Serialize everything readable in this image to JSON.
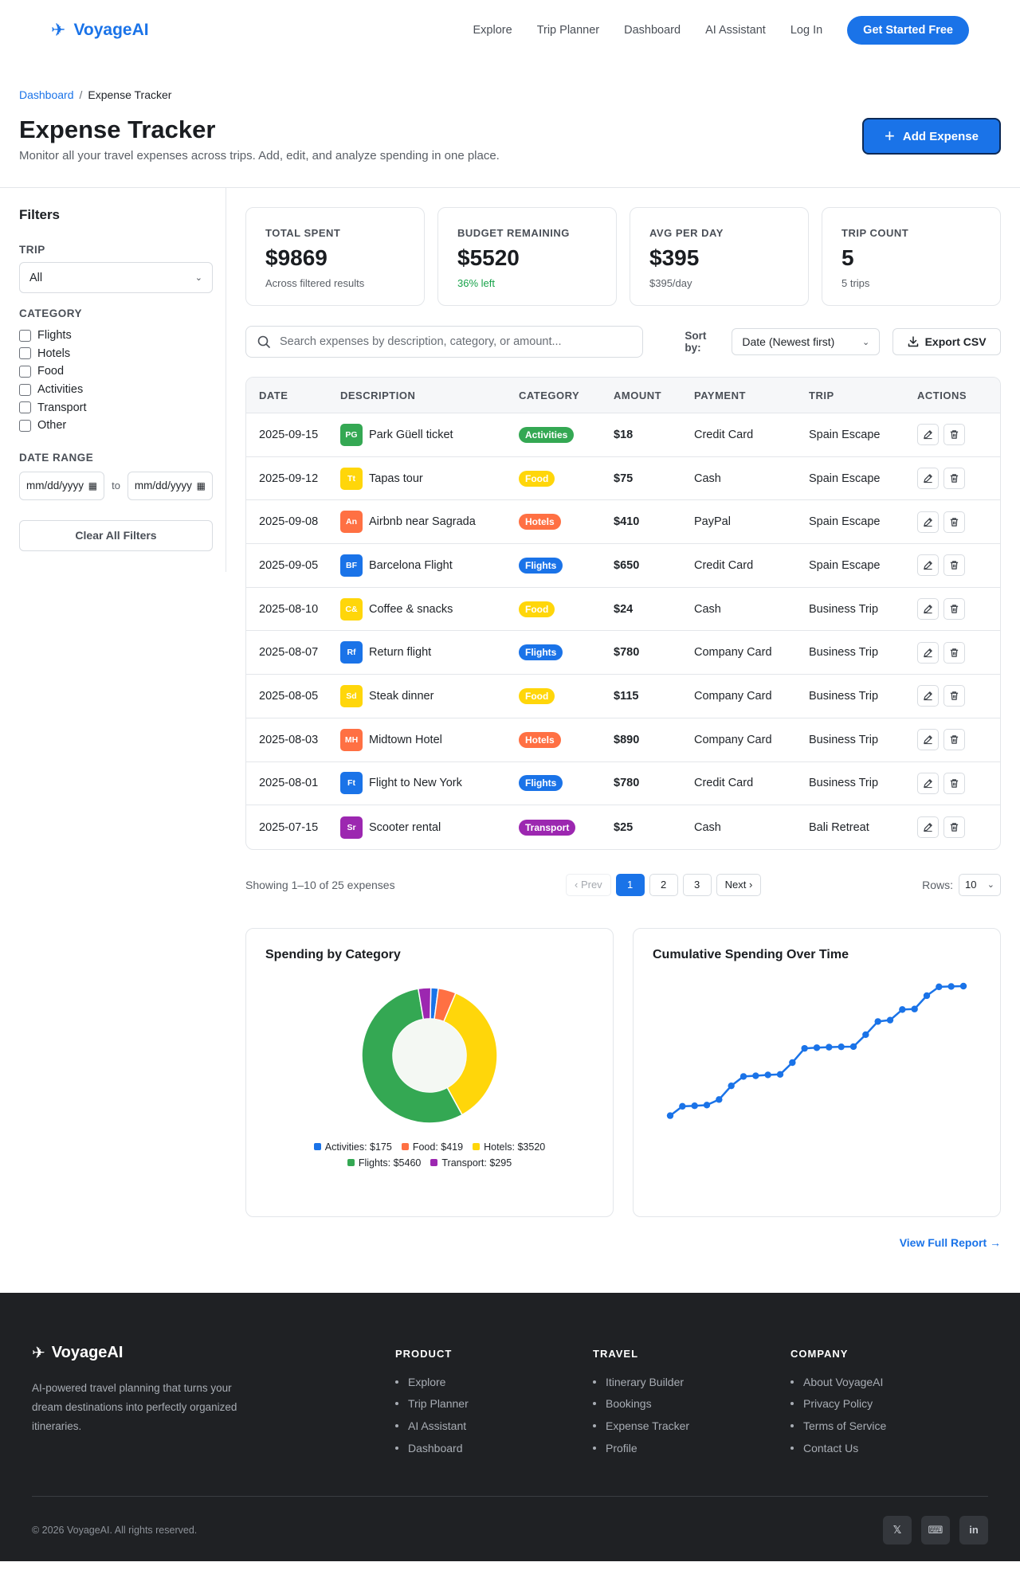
{
  "nav": {
    "brand": "VoyageAI",
    "links": [
      "Explore",
      "Trip Planner",
      "Dashboard",
      "AI Assistant",
      "Log In"
    ],
    "cta": "Get Started Free"
  },
  "breadcrumb": {
    "parent": "Dashboard",
    "sep": "/",
    "current": "Expense Tracker"
  },
  "header": {
    "title": "Expense Tracker",
    "subtitle": "Monitor all your travel expenses across trips. Add, edit, and analyze spending in one place.",
    "add_button": "Add Expense"
  },
  "filters": {
    "title": "Filters",
    "trip_label": "TRIP",
    "trip_value": "All",
    "category_label": "CATEGORY",
    "categories": [
      "Flights",
      "Hotels",
      "Food",
      "Activities",
      "Transport",
      "Other"
    ],
    "date_label": "DATE RANGE",
    "date_placeholder": "mm/dd/yyyy",
    "to": "to",
    "clear": "Clear All Filters"
  },
  "stats": [
    {
      "label": "TOTAL SPENT",
      "value": "$9869",
      "note": "Across filtered results"
    },
    {
      "label": "BUDGET REMAINING",
      "value": "$5520",
      "note": "36% left"
    },
    {
      "label": "AVG PER DAY",
      "value": "$395",
      "note": "$395/day"
    },
    {
      "label": "TRIP COUNT",
      "value": "5",
      "note": "5 trips"
    }
  ],
  "toolbar": {
    "search_placeholder": "Search expenses by description, category, or amount...",
    "sort_label": "Sort by:",
    "sort_value": "Date (Newest first)",
    "export": "Export CSV"
  },
  "table": {
    "headers": [
      "DATE",
      "DESCRIPTION",
      "CATEGORY",
      "AMOUNT",
      "PAYMENT",
      "TRIP",
      "ACTIONS"
    ],
    "rows": [
      {
        "date": "2025-09-15",
        "initials": "PG",
        "desc": "Park Güell ticket",
        "cat": "Activities",
        "amount": "$18",
        "payment": "Credit Card",
        "trip": "Spain Escape"
      },
      {
        "date": "2025-09-12",
        "initials": "Tt",
        "desc": "Tapas tour",
        "cat": "Food",
        "amount": "$75",
        "payment": "Cash",
        "trip": "Spain Escape"
      },
      {
        "date": "2025-09-08",
        "initials": "An",
        "desc": "Airbnb near Sagrada",
        "cat": "Hotels",
        "amount": "$410",
        "payment": "PayPal",
        "trip": "Spain Escape"
      },
      {
        "date": "2025-09-05",
        "initials": "BF",
        "desc": "Barcelona Flight",
        "cat": "Flights",
        "amount": "$650",
        "payment": "Credit Card",
        "trip": "Spain Escape"
      },
      {
        "date": "2025-08-10",
        "initials": "C&",
        "desc": "Coffee & snacks",
        "cat": "Food",
        "amount": "$24",
        "payment": "Cash",
        "trip": "Business Trip"
      },
      {
        "date": "2025-08-07",
        "initials": "Rf",
        "desc": "Return flight",
        "cat": "Flights",
        "amount": "$780",
        "payment": "Company Card",
        "trip": "Business Trip"
      },
      {
        "date": "2025-08-05",
        "initials": "Sd",
        "desc": "Steak dinner",
        "cat": "Food",
        "amount": "$115",
        "payment": "Company Card",
        "trip": "Business Trip"
      },
      {
        "date": "2025-08-03",
        "initials": "MH",
        "desc": "Midtown Hotel",
        "cat": "Hotels",
        "amount": "$890",
        "payment": "Company Card",
        "trip": "Business Trip"
      },
      {
        "date": "2025-08-01",
        "initials": "Ft",
        "desc": "Flight to New York",
        "cat": "Flights",
        "amount": "$780",
        "payment": "Credit Card",
        "trip": "Business Trip"
      },
      {
        "date": "2025-07-15",
        "initials": "Sr",
        "desc": "Scooter rental",
        "cat": "Transport",
        "amount": "$25",
        "payment": "Cash",
        "trip": "Bali Retreat"
      }
    ]
  },
  "category_colors": {
    "Activities": "#34a853",
    "Food": "#ffd60a",
    "Hotels": "#ff7043",
    "Flights": "#1a73e8",
    "Transport": "#9c27b0"
  },
  "pagination": {
    "showing": "Showing 1–10 of 25 expenses",
    "prev": "‹ Prev",
    "pages": [
      "1",
      "2",
      "3"
    ],
    "next": "Next ›",
    "rows_label": "Rows:",
    "rows_value": "10"
  },
  "charts_titles": {
    "pie": "Spending by Category",
    "line": "Cumulative Spending Over Time"
  },
  "chart_data": [
    {
      "type": "pie",
      "title": "Spending by Category",
      "slices": [
        {
          "name": "Activities",
          "value": 175,
          "label": "Activities: $175",
          "color": "#1a73e8"
        },
        {
          "name": "Food",
          "value": 419,
          "label": "Food: $419",
          "color": "#ff7043"
        },
        {
          "name": "Hotels",
          "value": 3520,
          "label": "Hotels: $3520",
          "color": "#ffd60a"
        },
        {
          "name": "Flights",
          "value": 5460,
          "label": "Flights: $5460",
          "color": "#34a853"
        },
        {
          "name": "Transport",
          "value": 295,
          "label": "Transport: $295",
          "color": "#9c27b0"
        }
      ]
    },
    {
      "type": "line",
      "title": "Cumulative Spending Over Time",
      "values": [
        340,
        880,
        910,
        950,
        1270,
        2060,
        2600,
        2640,
        2690,
        2720,
        3400,
        4220,
        4260,
        4290,
        4310,
        4320,
        5010,
        5770,
        5850,
        6460,
        6490,
        7260,
        7770,
        7790,
        7810
      ],
      "color": "#1a73e8"
    }
  ],
  "view_report": "View Full Report →",
  "footer": {
    "brand": "VoyageAI",
    "desc": "AI-powered travel planning that turns your dream destinations into perfectly organized itineraries.",
    "columns": [
      {
        "title": "PRODUCT",
        "links": [
          "Explore",
          "Trip Planner",
          "AI Assistant",
          "Dashboard"
        ]
      },
      {
        "title": "TRAVEL",
        "links": [
          "Itinerary Builder",
          "Bookings",
          "Expense Tracker",
          "Profile"
        ]
      },
      {
        "title": "COMPANY",
        "links": [
          "About VoyageAI",
          "Privacy Policy",
          "Terms of Service",
          "Contact Us"
        ]
      }
    ],
    "copyright": "© 2026 VoyageAI. All rights reserved.",
    "socials": [
      "𝕏",
      "⌨",
      "in"
    ]
  }
}
